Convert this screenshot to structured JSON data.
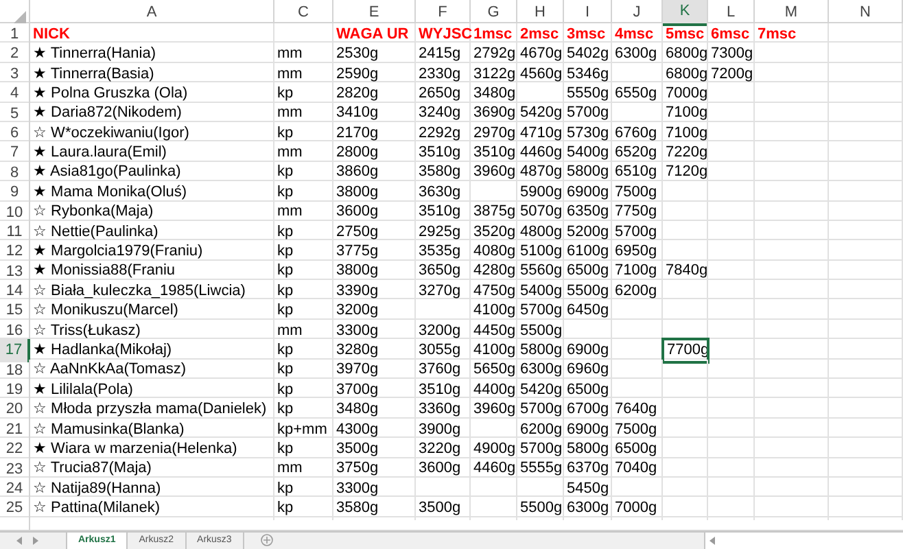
{
  "columns": [
    {
      "label": "A",
      "selected": false
    },
    {
      "label": "C",
      "selected": false
    },
    {
      "label": "E",
      "selected": false
    },
    {
      "label": "F",
      "selected": false
    },
    {
      "label": "G",
      "selected": false
    },
    {
      "label": "H",
      "selected": false
    },
    {
      "label": "I",
      "selected": false
    },
    {
      "label": "J",
      "selected": false
    },
    {
      "label": "K",
      "selected": true
    },
    {
      "label": "L",
      "selected": false
    },
    {
      "label": "M",
      "selected": false
    },
    {
      "label": "N",
      "selected": false
    }
  ],
  "rows": [
    {
      "number": "1",
      "kind": "header",
      "selected": false,
      "cells": [
        "NICK",
        null,
        "WAGA UR",
        "WYJSC",
        "1msc",
        "2msc",
        "3msc",
        "4msc",
        "5msc",
        "6msc",
        "7msc"
      ]
    },
    {
      "number": "2",
      "kind": "data",
      "selected": false,
      "cells": [
        "★ Tinnerra(Hania)",
        "mm",
        "2530g",
        "2415g",
        "2792g",
        "4670g",
        "5402g",
        "6300g",
        "6800g",
        "7300g"
      ]
    },
    {
      "number": "3",
      "kind": "data",
      "selected": false,
      "cells": [
        "★ Tinnerra(Basia)",
        "mm",
        "2590g",
        "2330g",
        "3122g",
        "4560g",
        "5346g",
        null,
        "6800g",
        "7200g"
      ]
    },
    {
      "number": "4",
      "kind": "data",
      "selected": false,
      "cells": [
        "★ Polna Gruszka (Ola)",
        "kp",
        "2820g",
        "2650g",
        "3480g",
        null,
        "5550g",
        "6550g",
        "7000g"
      ]
    },
    {
      "number": "5",
      "kind": "data",
      "selected": false,
      "cells": [
        "★ Daria872(Nikodem)",
        "mm",
        "3410g",
        "3240g",
        "3690g",
        "5420g",
        "5700g",
        null,
        "7100g"
      ]
    },
    {
      "number": "6",
      "kind": "data",
      "selected": false,
      "cells": [
        "☆ W*oczekiwaniu(Igor)",
        "kp",
        "2170g",
        "2292g",
        "2970g",
        "4710g",
        "5730g",
        "6760g",
        "7100g"
      ]
    },
    {
      "number": "7",
      "kind": "data",
      "selected": false,
      "cells": [
        "★ Laura.laura(Emil)",
        "mm",
        "2800g",
        "3510g",
        "3510g",
        "4460g",
        "5400g",
        "6520g",
        "7220g"
      ]
    },
    {
      "number": "8",
      "kind": "data",
      "selected": false,
      "cells": [
        "★ Asia81go(Paulinka)",
        "kp",
        "3860g",
        "3580g",
        "3960g",
        "4870g",
        "5800g",
        "6510g",
        "7120g"
      ]
    },
    {
      "number": "9",
      "kind": "data",
      "selected": false,
      "cells": [
        "★ Mama Monika(Oluś)",
        "kp",
        "3800g",
        "3630g",
        null,
        "5900g",
        "6900g",
        "7500g"
      ]
    },
    {
      "number": "10",
      "kind": "data",
      "selected": false,
      "cells": [
        "☆ Rybonka(Maja)",
        "mm",
        "3600g",
        "3510g",
        "3875g",
        "5070g",
        "6350g",
        "7750g"
      ]
    },
    {
      "number": "11",
      "kind": "data",
      "selected": false,
      "cells": [
        "☆ Nettie(Paulinka)",
        "kp",
        "2750g",
        "2925g",
        "3520g",
        "4800g",
        "5200g",
        "5700g"
      ]
    },
    {
      "number": "12",
      "kind": "data",
      "selected": false,
      "cells": [
        "★ Margolcia1979(Franiu)",
        "kp",
        "3775g",
        "3535g",
        "4080g",
        "5100g",
        "6100g",
        "6950g"
      ]
    },
    {
      "number": "13",
      "kind": "data",
      "selected": false,
      "cells": [
        "★ Monissia88(Franiu",
        "kp",
        "3800g",
        "3650g",
        "4280g",
        "5560g",
        "6500g",
        "7100g",
        "7840g"
      ]
    },
    {
      "number": "14",
      "kind": "data",
      "selected": false,
      "cells": [
        "☆ Biała_kuleczka_1985(Liwcia)",
        "kp",
        "3390g",
        "3270g",
        "4750g",
        "5400g",
        "5500g",
        "6200g"
      ]
    },
    {
      "number": "15",
      "kind": "data",
      "selected": false,
      "cells": [
        "☆ Monikuszu(Marcel)",
        "kp",
        "3200g",
        null,
        "4100g",
        "5700g",
        "6450g"
      ]
    },
    {
      "number": "16",
      "kind": "data",
      "selected": false,
      "cells": [
        "☆ Triss(Łukasz)",
        "mm",
        "3300g",
        "3200g",
        "4450g",
        "5500g"
      ]
    },
    {
      "number": "17",
      "kind": "data",
      "selected": true,
      "cells": [
        "★ Hadlanka(Mikołaj)",
        "kp",
        "3280g",
        "3055g",
        "4100g",
        "5800g",
        "6900g",
        null,
        "7700g"
      ]
    },
    {
      "number": "18",
      "kind": "data",
      "selected": false,
      "cells": [
        "☆ AaNnKkAa(Tomasz)",
        "kp",
        "3970g",
        "3760g",
        "5650g",
        "6300g",
        "6960g"
      ]
    },
    {
      "number": "19",
      "kind": "data",
      "selected": false,
      "cells": [
        "★ Lililala(Pola)",
        "kp",
        "3700g",
        "3510g",
        "4400g",
        "5420g",
        "6500g"
      ]
    },
    {
      "number": "20",
      "kind": "data",
      "selected": false,
      "cells": [
        "☆ Młoda przyszła mama(Danielek)",
        "kp",
        "3480g",
        "3360g",
        "3960g",
        "5700g",
        "6700g",
        "7640g"
      ]
    },
    {
      "number": "21",
      "kind": "data",
      "selected": false,
      "cells": [
        "☆ Mamusinka(Blanka)",
        "kp+mm",
        "4300g",
        "3900g",
        null,
        "6200g",
        "6900g",
        "7500g"
      ]
    },
    {
      "number": "22",
      "kind": "data",
      "selected": false,
      "cells": [
        "★ Wiara w marzenia(Helenka)",
        "kp",
        "3500g",
        "3220g",
        "4900g",
        "5700g",
        "5800g",
        "6500g"
      ]
    },
    {
      "number": "23",
      "kind": "data",
      "selected": false,
      "cells": [
        "☆ Trucia87(Maja)",
        "mm",
        "3750g",
        "3600g",
        "4460g",
        "5555g",
        "6370g",
        "7040g"
      ]
    },
    {
      "number": "24",
      "kind": "data",
      "selected": false,
      "cells": [
        "☆ Natija89(Hanna)",
        "kp",
        "3300g",
        null,
        null,
        null,
        "5450g"
      ]
    },
    {
      "number": "25",
      "kind": "data",
      "selected": false,
      "cells": [
        "☆ Pattina(Milanek)",
        "kp",
        "3580g",
        "3500g",
        null,
        "5500g",
        "6300g",
        "7000g"
      ]
    }
  ],
  "sheet_tabs": [
    {
      "label": "Arkusz1",
      "selected": true
    },
    {
      "label": "Arkusz2",
      "selected": false
    },
    {
      "label": "Arkusz3",
      "selected": false
    }
  ]
}
